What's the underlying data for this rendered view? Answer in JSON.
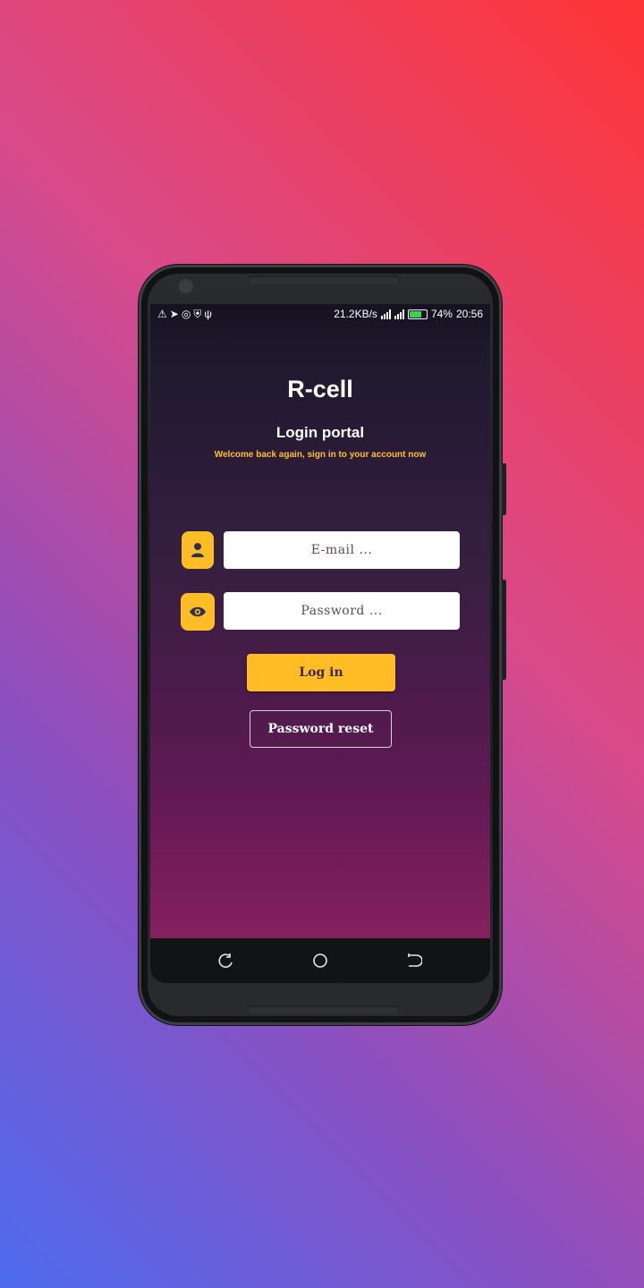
{
  "statusbar": {
    "left_icons": [
      "alert-triangle-icon",
      "telegram-icon",
      "whatsapp-icon",
      "shield-icon",
      "usb-icon"
    ],
    "speed": "21.2KB/s",
    "battery_percent": "74%",
    "battery_level": 0.74,
    "time": "20:56"
  },
  "app": {
    "title": "R-cell",
    "subtitle": "Login portal",
    "tagline": "Welcome back again, sign in to your account now"
  },
  "form": {
    "email_placeholder": "E-mail ...",
    "email_value": "",
    "password_placeholder": "Password ...",
    "password_value": "",
    "login_label": "Log in",
    "reset_label": "Password reset"
  },
  "navbar": {
    "icons": [
      "recent-apps-icon",
      "home-icon",
      "back-icon"
    ]
  },
  "colors": {
    "accent": "#ffbd25",
    "tagline": "#ffc02a",
    "background_start": "#4e6cf0",
    "background_end": "#ff3535"
  }
}
